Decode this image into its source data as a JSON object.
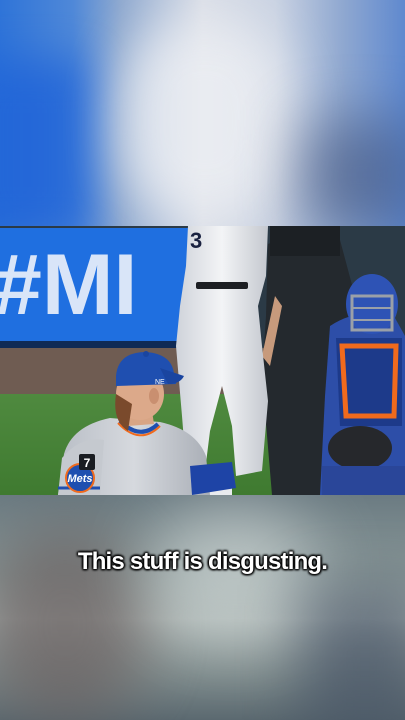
{
  "caption": {
    "text": "This stuff is disgusting."
  },
  "scene": {
    "billboard_text": "#MI",
    "jersey_patch_number": "7",
    "sleeve_patch_text": "Mets",
    "colors": {
      "billboard_blue": "#1f6fe0",
      "cap_blue": "#1f4fb0",
      "mets_orange": "#f06a1d",
      "grass": "#4a8a3a"
    }
  }
}
